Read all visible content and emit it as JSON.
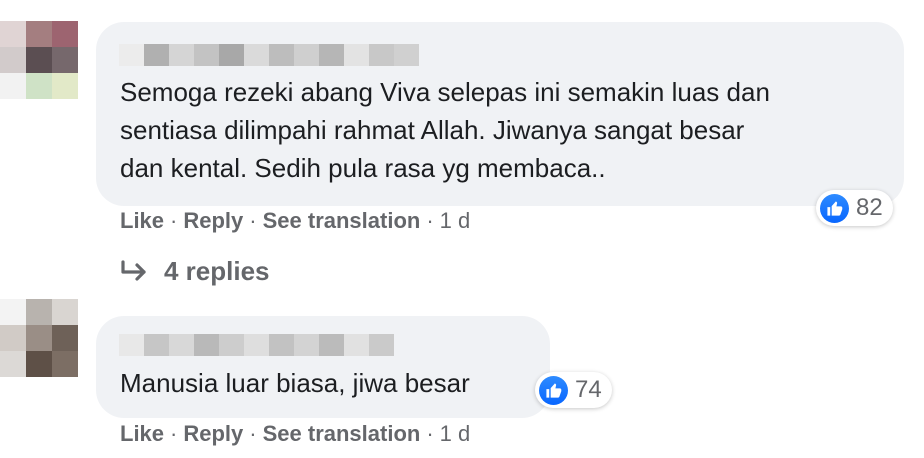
{
  "colors": {
    "bubble_bg": "#f0f2f5",
    "text": "#1c1e21",
    "meta": "#65676b",
    "like_blue": "#0866ff"
  },
  "comments": [
    {
      "avatar_pixels": [
        "#e0d4d4",
        "#a47e80",
        "#9d6470",
        "#d2cbcb",
        "#5b4e52",
        "#76686c",
        "#f2f2f2",
        "#cfe2c6",
        "#e2e9c8"
      ],
      "name_pixels": [
        "#ececec",
        "#b0b0b0",
        "#d5d5d5",
        "#c3c3c3",
        "#a8a8a8",
        "#dadada",
        "#bdbdbd",
        "#cfcfcf",
        "#b6b6b6",
        "#e3e3e3",
        "#c8c8c8",
        "#d0d0d0"
      ],
      "text_lines": [
        "Semoga rezeki abang Viva selepas ini semakin luas dan",
        "sentiasa dilimpahi rahmat Allah. Jiwanya sangat besar",
        "dan kental. Sedih pula rasa yg membaca.."
      ],
      "reaction_icon": "thumbs-up-icon",
      "reaction_count": "82",
      "actions": {
        "like": "Like",
        "reply": "Reply",
        "translate": "See translation",
        "time": "1 d"
      },
      "replies_label": "4 replies",
      "replies_icon": "reply-arrow-icon"
    },
    {
      "avatar_pixels": [
        "#f3f3f3",
        "#b8b3ae",
        "#d9d5d1",
        "#d1cbc6",
        "#9a8e86",
        "#6e6158",
        "#dcd9d6",
        "#5e5047",
        "#7c6e64"
      ],
      "name_pixels": [
        "#e8e8e8",
        "#c6c6c6",
        "#d8d8d8",
        "#b9b9b9",
        "#cdcdcd",
        "#dedede",
        "#c2c2c2",
        "#d3d3d3",
        "#bbbbbb",
        "#e1e1e1",
        "#cacaca"
      ],
      "text_lines": [
        "Manusia luar biasa, jiwa besar"
      ],
      "reaction_icon": "thumbs-up-icon",
      "reaction_count": "74",
      "actions": {
        "like": "Like",
        "reply": "Reply",
        "translate": "See translation",
        "time": "1 d"
      }
    }
  ]
}
